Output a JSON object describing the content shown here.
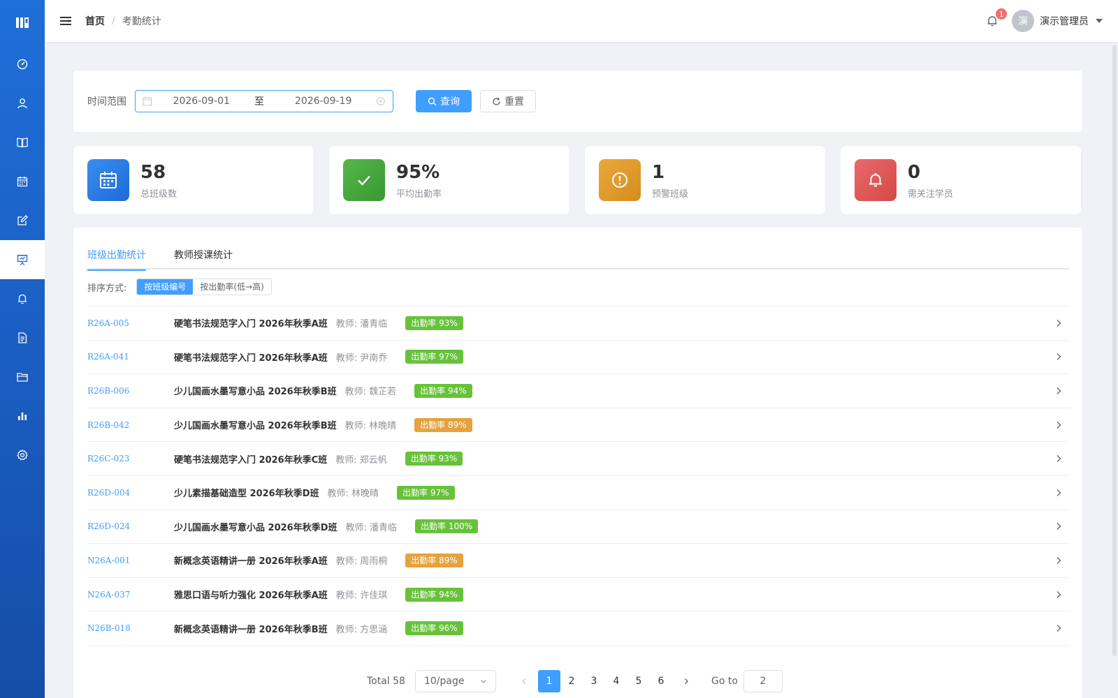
{
  "header": {
    "breadcrumb_home": "首页",
    "breadcrumb_sep": "/",
    "breadcrumb_current": "考勤统计",
    "notification_count": "1",
    "avatar_text": "演",
    "username": "演示管理员"
  },
  "sidebar": {
    "items": [
      {
        "icon": "dashboard-icon",
        "active": false
      },
      {
        "icon": "user-icon",
        "active": false
      },
      {
        "icon": "book-icon",
        "active": false
      },
      {
        "icon": "calendar-icon",
        "active": false
      },
      {
        "icon": "edit-icon",
        "active": false
      },
      {
        "icon": "presentation-icon",
        "active": true
      },
      {
        "icon": "bell-icon",
        "active": false
      },
      {
        "icon": "document-icon",
        "active": false
      },
      {
        "icon": "folder-icon",
        "active": false
      },
      {
        "icon": "bar-chart-icon",
        "active": false
      },
      {
        "icon": "gear-icon",
        "active": false
      }
    ]
  },
  "filter": {
    "label": "时间范围",
    "start_date": "2026-09-01",
    "separator": "至",
    "end_date": "2026-09-19",
    "search_label": "查询",
    "reset_label": "重置"
  },
  "stats": [
    {
      "value": "58",
      "label": "总班级数",
      "color": "#2f7ce8",
      "icon": "calendar-icon"
    },
    {
      "value": "95%",
      "label": "平均出勤率",
      "color": "#44a83c",
      "icon": "check-icon"
    },
    {
      "value": "1",
      "label": "预警班级",
      "color": "#e0a030",
      "icon": "alert-icon"
    },
    {
      "value": "0",
      "label": "需关注学员",
      "color": "#e05a5a",
      "icon": "bell-icon"
    }
  ],
  "tabs": [
    {
      "label": "班级出勤统计",
      "active": true
    },
    {
      "label": "教师授课统计",
      "active": false
    }
  ],
  "sort": {
    "label": "排序方式:",
    "options": [
      {
        "label": "按班级编号",
        "active": true
      },
      {
        "label": "按出勤率(低→高)",
        "active": false
      }
    ]
  },
  "rows": [
    {
      "code": "R26A-005",
      "name": "硬笔书法规范字入门 2026年秋季A班",
      "teacher": "教师: 潘青临",
      "rate": "出勤率 93%",
      "status": "good"
    },
    {
      "code": "R26A-041",
      "name": "硬笔书法规范字入门 2026年秋季A班",
      "teacher": "教师: 尹南乔",
      "rate": "出勤率 97%",
      "status": "good"
    },
    {
      "code": "R26B-006",
      "name": "少儿国画水墨写意小品 2026年秋季B班",
      "teacher": "教师: 魏芷若",
      "rate": "出勤率 94%",
      "status": "good"
    },
    {
      "code": "R26B-042",
      "name": "少儿国画水墨写意小品 2026年秋季B班",
      "teacher": "教师: 林晚晴",
      "rate": "出勤率 89%",
      "status": "warn"
    },
    {
      "code": "R26C-023",
      "name": "硬笔书法规范字入门 2026年秋季C班",
      "teacher": "教师: 郑云帆",
      "rate": "出勤率 93%",
      "status": "good"
    },
    {
      "code": "R26D-004",
      "name": "少儿素描基础造型 2026年秋季D班",
      "teacher": "教师: 林晚晴",
      "rate": "出勤率 97%",
      "status": "good"
    },
    {
      "code": "R26D-024",
      "name": "少儿国画水墨写意小品 2026年秋季D班",
      "teacher": "教师: 潘青临",
      "rate": "出勤率 100%",
      "status": "good"
    },
    {
      "code": "N26A-001",
      "name": "新概念英语精讲一册 2026年秋季A班",
      "teacher": "教师: 周雨桐",
      "rate": "出勤率 89%",
      "status": "warn"
    },
    {
      "code": "N26A-037",
      "name": "雅思口语与听力强化 2026年秋季A班",
      "teacher": "教师: 许佳琪",
      "rate": "出勤率 94%",
      "status": "good"
    },
    {
      "code": "N26B-018",
      "name": "新概念英语精讲一册 2026年秋季B班",
      "teacher": "教师: 方思涵",
      "rate": "出勤率 96%",
      "status": "good"
    }
  ],
  "pagination": {
    "total_label": "Total 58",
    "page_size": "10/page",
    "pages": [
      "1",
      "2",
      "3",
      "4",
      "5",
      "6"
    ],
    "current_page": "1",
    "goto_label": "Go to",
    "goto_value": "2"
  },
  "colors": {
    "primary": "#409eff",
    "good": "#67c23a",
    "warn": "#e6a23c",
    "sidebar_top": "#1f6fd9",
    "sidebar_bottom": "#154da6"
  }
}
